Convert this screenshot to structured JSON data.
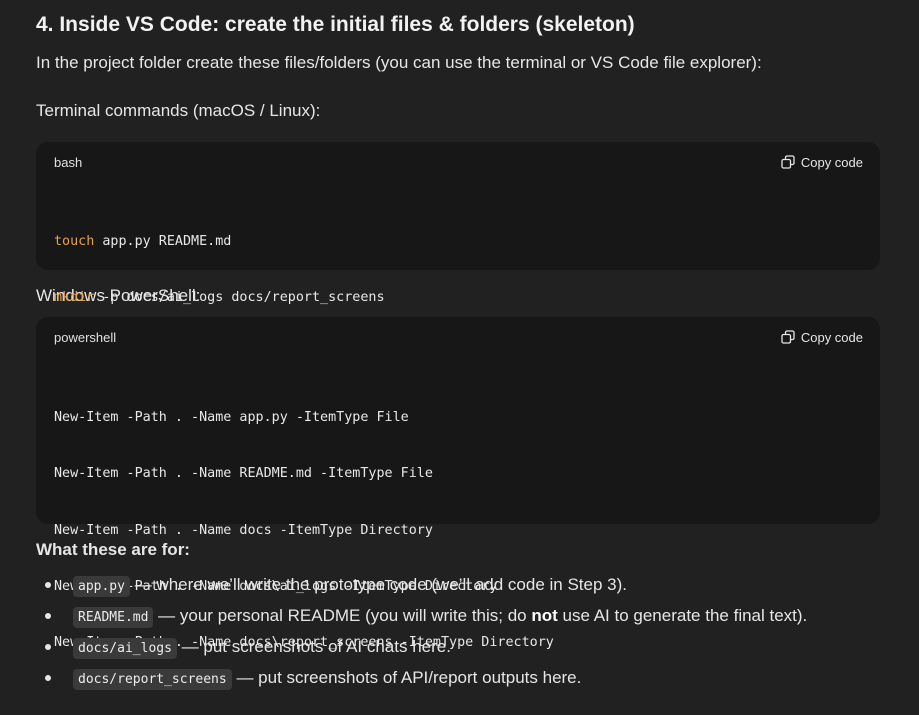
{
  "heading": "4. Inside VS Code: create the initial files & folders (skeleton)",
  "intro": "In the project folder create these files/folders (you can use the terminal or VS Code file explorer):",
  "terminal_label": "Terminal commands (macOS / Linux):",
  "bash_block": {
    "language": "bash",
    "copy_label": "Copy code",
    "lines": [
      {
        "cmd": "touch",
        "rest": " app.py README.md"
      },
      {
        "cmd": "mkdir",
        "rest": " -p docs/ai_logs docs/report_screens"
      }
    ]
  },
  "powershell_label": "Windows PowerShell:",
  "powershell_block": {
    "language": "powershell",
    "copy_label": "Copy code",
    "lines": [
      "New-Item -Path . -Name app.py -ItemType File",
      "New-Item -Path . -Name README.md -ItemType File",
      "New-Item -Path . -Name docs -ItemType Directory",
      "New-Item -Path . -Name docs\\ai_logs -ItemType Directory",
      "New-Item -Path . -Name docs\\report_screens -ItemType Directory"
    ]
  },
  "what_label": "What these are for:",
  "items": [
    {
      "code": "app.py",
      "text": " — where we’ll write the prototype code (we’ll add code in Step 3)."
    },
    {
      "code": "README.md",
      "text_before": " — your personal README (you will write this; do ",
      "bold": "not",
      "text_after": " use AI to generate the final text)."
    },
    {
      "code": "docs/ai_logs",
      "text": " — put screenshots of AI chats here."
    },
    {
      "code": "docs/report_screens",
      "text": " — put screenshots of API/report outputs here."
    }
  ],
  "colors": {
    "background": "#212121",
    "code_background": "#171717",
    "keyword": "#e5a14b",
    "inline_code_bg": "#3a3a3a"
  }
}
